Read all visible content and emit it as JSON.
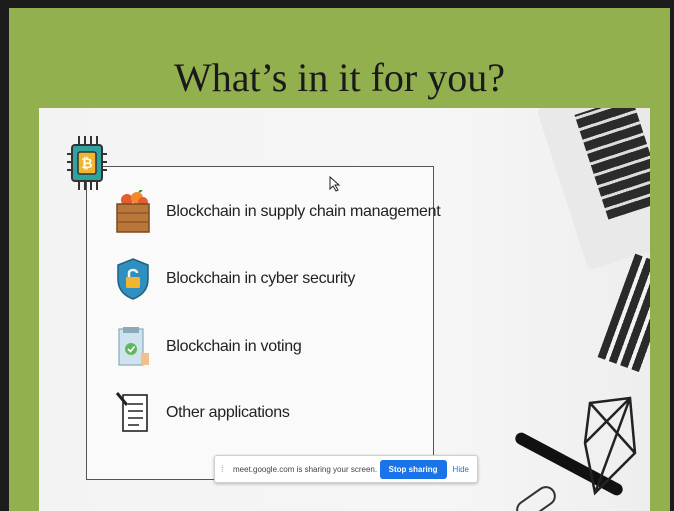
{
  "slide": {
    "title": "What’s in it for you?",
    "items": [
      {
        "icon": "crate-of-fruit-icon",
        "label": "Blockchain in supply chain management"
      },
      {
        "icon": "shield-lock-icon",
        "label": "Blockchain in cyber security"
      },
      {
        "icon": "ballot-box-icon",
        "label": "Blockchain in voting"
      },
      {
        "icon": "document-list-icon",
        "label": "Other applications"
      }
    ],
    "colors": {
      "background": "#93b04f",
      "card": "#fafafa"
    }
  },
  "screen_share_bar": {
    "message": "meet.google.com is sharing your screen.",
    "stop_label": "Stop sharing",
    "hide_label": "Hide",
    "grip_icon": "drag-handle-icon"
  }
}
